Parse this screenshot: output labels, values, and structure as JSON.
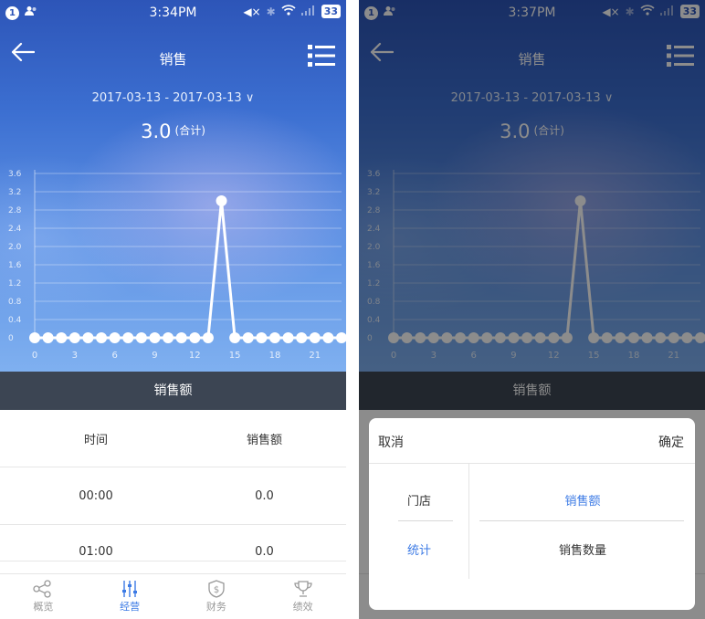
{
  "left": {
    "status": {
      "notif_count": "1",
      "time": "3:34PM",
      "battery": "33"
    },
    "nav": {
      "title": "销售"
    },
    "date_range": "2017-03-13 - 2017-03-13 ∨",
    "total": {
      "value": "3.0",
      "suffix": "(合计)"
    },
    "chart_data": {
      "type": "line",
      "x": [
        0,
        1,
        2,
        3,
        4,
        5,
        6,
        7,
        8,
        9,
        10,
        11,
        12,
        13,
        14,
        15,
        16,
        17,
        18,
        19,
        20,
        21,
        22,
        23
      ],
      "values": [
        0,
        0,
        0,
        0,
        0,
        0,
        0,
        0,
        0,
        0,
        0,
        0,
        0,
        0,
        3,
        0,
        0,
        0,
        0,
        0,
        0,
        0,
        0,
        0
      ],
      "x_tick_labels": [
        "0",
        "3",
        "6",
        "9",
        "12",
        "15",
        "18",
        "21"
      ],
      "y_tick_labels": [
        "0",
        "0.4",
        "0.8",
        "1.2",
        "1.6",
        "2.0",
        "2.4",
        "2.8",
        "3.2",
        "3.6"
      ],
      "ylim": [
        0,
        3.6
      ],
      "grid": true,
      "color": "#ffffff"
    },
    "section_title": "销售额",
    "table": {
      "headers": [
        "时间",
        "销售额"
      ],
      "rows": [
        [
          "00:00",
          "0.0"
        ],
        [
          "01:00",
          "0.0"
        ]
      ]
    },
    "tabs": [
      {
        "label": "概览",
        "icon": "share-icon"
      },
      {
        "label": "经营",
        "icon": "sliders-icon",
        "active": true
      },
      {
        "label": "财务",
        "icon": "dollar-icon"
      },
      {
        "label": "绩效",
        "icon": "trophy-icon"
      }
    ]
  },
  "right": {
    "status": {
      "notif_count": "1",
      "time": "3:37PM",
      "battery": "33"
    },
    "nav": {
      "title": "销售"
    },
    "date_range": "2017-03-13 - 2017-03-13 ∨",
    "total": {
      "value": "3.0",
      "suffix": "(合计)"
    },
    "section_title": "销售额",
    "sheet": {
      "cancel_label": "取消",
      "confirm_label": "确定",
      "left_options": [
        "门店",
        "统计"
      ],
      "left_selected_index": 1,
      "right_options": [
        "销售额",
        "销售数量"
      ],
      "right_selected_index": 0,
      "accent_color": "#3d7be5"
    },
    "tabs": [
      "概览",
      "经营",
      "财务",
      "绩效"
    ]
  },
  "colors": {
    "accent": "#3d7be5",
    "section_bar": "#3c4553"
  }
}
